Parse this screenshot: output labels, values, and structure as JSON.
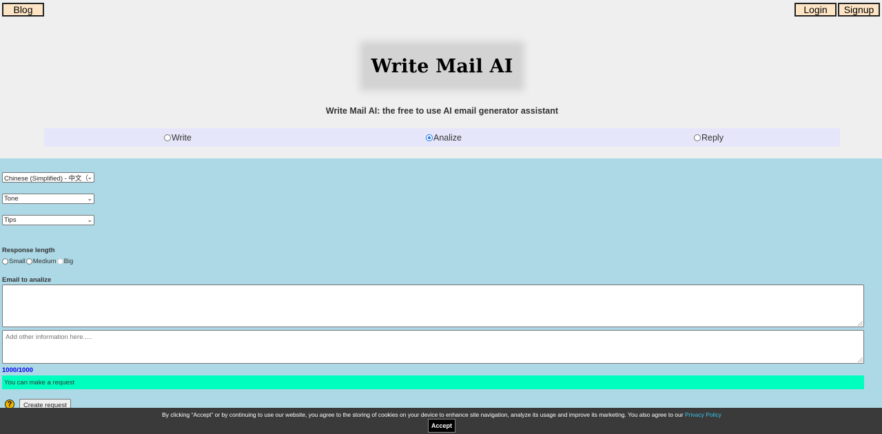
{
  "header": {
    "blog_label": "Blog",
    "login_label": "Login",
    "signup_label": "Signup",
    "title": "Write Mail AI",
    "subtitle": "Write Mail AI: the free to use AI email generator assistant"
  },
  "modes": {
    "items": [
      {
        "label": "Write",
        "checked": false
      },
      {
        "label": "Analize",
        "checked": true
      },
      {
        "label": "Reply",
        "checked": false
      }
    ]
  },
  "form": {
    "language_select": "Chinese (Simplified) - 中文（",
    "tone_select": "Tone",
    "tips_select": "Tips",
    "response_length_label": "Response length",
    "length_options": [
      "Small",
      "Medium",
      "Big"
    ],
    "email_label": "Email to analize",
    "email_value": "",
    "info_placeholder": "Add other information here.....",
    "counter": "1000/1000",
    "status": "You can make a request",
    "help_icon_glyph": "?",
    "create_label": "Create request"
  },
  "cookie": {
    "text": "By clicking “Accept” or by continuing to use our website, you agree to the storing of cookies on your device to enhance site navigation, analyze its usage and improve its marketing. You also agree to our",
    "link": "Privacy Policy",
    "accept_label": "Accept"
  },
  "colors": {
    "header_bg": "#efefef",
    "form_bg": "#add8e6",
    "mode_bar_bg": "#e6e6fa",
    "status_bg": "#00ffbf",
    "top_button_bg": "#fde4c4",
    "counter_color": "#0000ee",
    "cookie_bg": "#3a3a3a",
    "link_color": "#36c5e8"
  }
}
